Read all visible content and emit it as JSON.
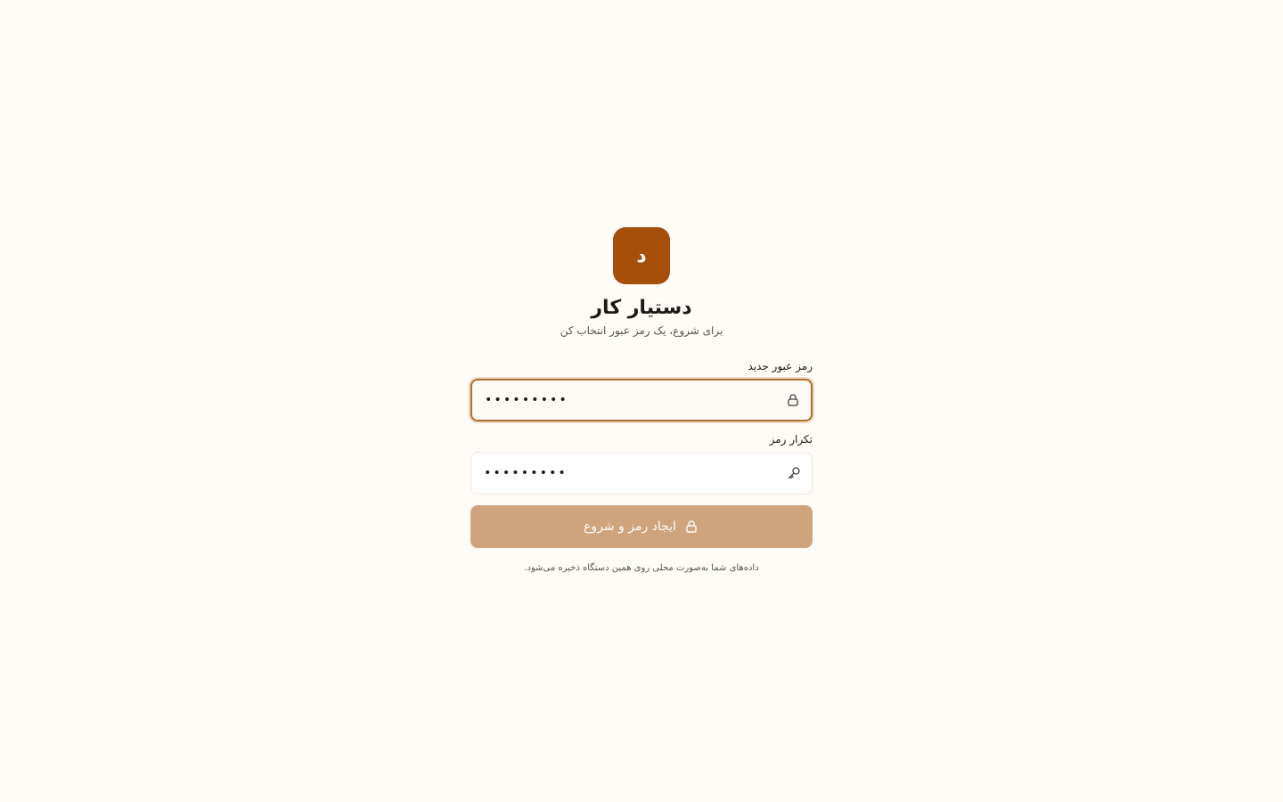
{
  "app": {
    "logo_letter": "د",
    "title": "دستیار کار",
    "subtitle": "برای شروع، یک رمز عبور انتخاب کن"
  },
  "form": {
    "new_password": {
      "label": "رمز عبور جدید",
      "value": "•••••••••",
      "icon": "lock-icon",
      "focused": true
    },
    "confirm_password": {
      "label": "تکرار رمز",
      "value": "•••••••••",
      "icon": "key-icon"
    },
    "submit": {
      "label": "ایجاد رمز و شروع",
      "icon": "lock-icon"
    }
  },
  "footer": {
    "note": "داده‌های شما به‌صورت محلی روی همین دستگاه ذخیره می‌شود."
  },
  "colors": {
    "background": "#fffcf8",
    "brand": "#a54f0b",
    "button": "#cfa37b",
    "focus_ring": "#b56d2c"
  }
}
